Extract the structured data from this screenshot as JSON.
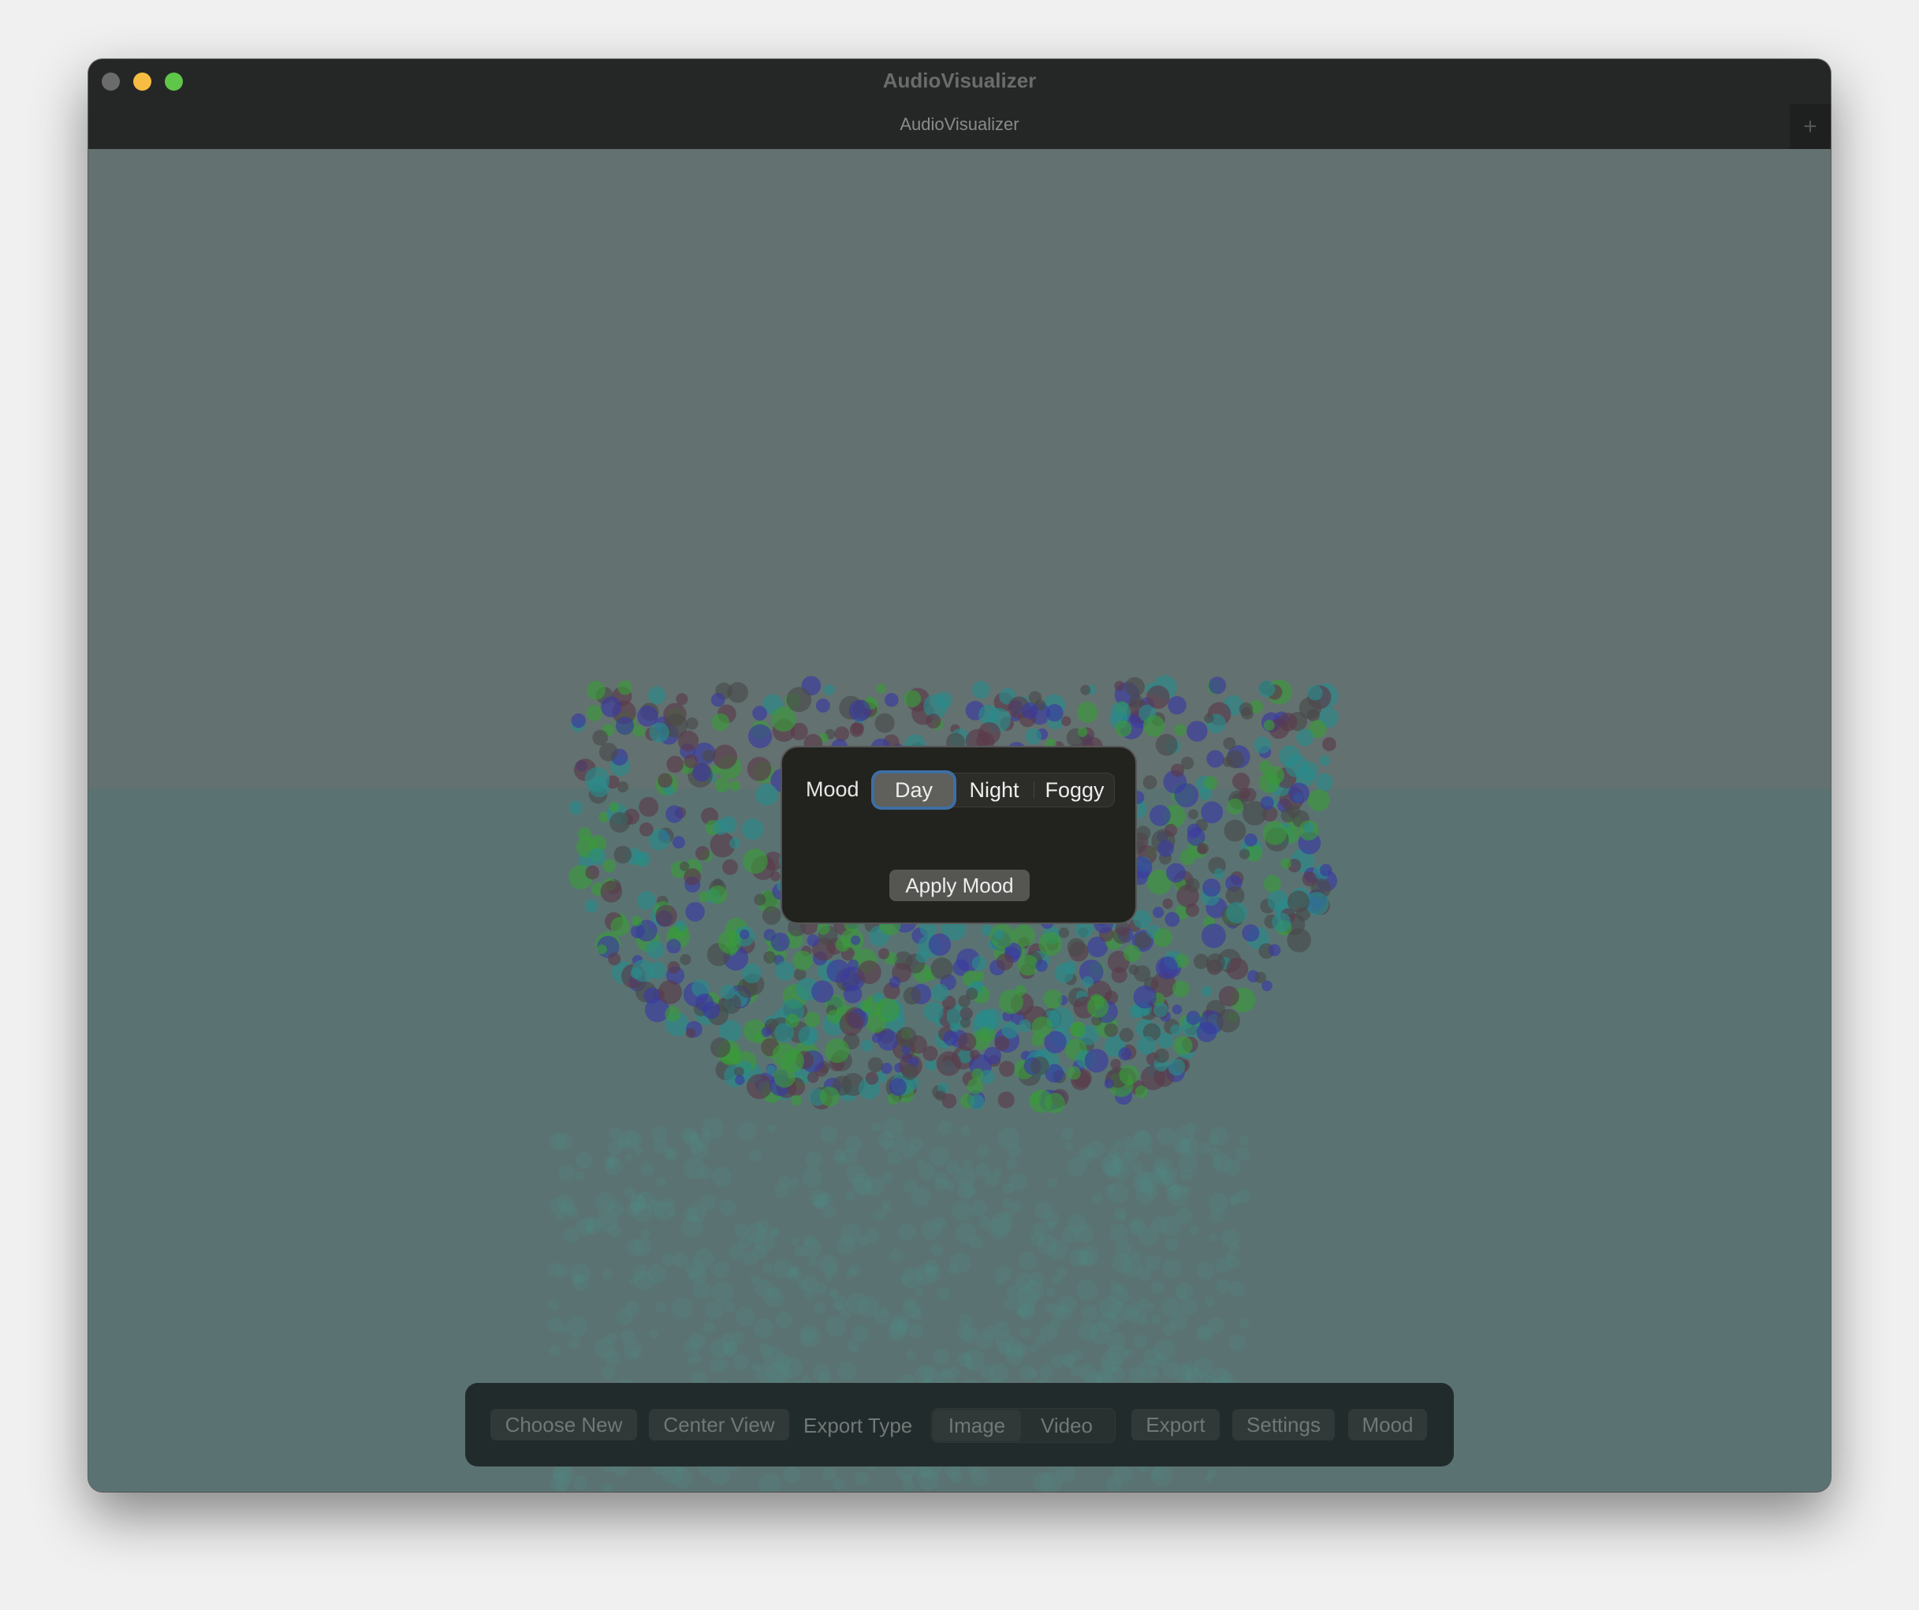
{
  "window": {
    "title": "AudioVisualizer",
    "tab_title": "AudioVisualizer",
    "new_tab_icon": "plus-icon",
    "traffic_lights": {
      "close": "#6b6b6b",
      "minimize": "#f6bd42",
      "maximize": "#5fc64a"
    }
  },
  "scene": {
    "sky_color": "#637170",
    "ground_color": "#5a7372",
    "particle_colors": [
      "#3a3aa0",
      "#3a9a3a",
      "#2a8a8a",
      "#5a3a4a",
      "#4a4a4a"
    ]
  },
  "mood_dialog": {
    "label": "Mood",
    "options": [
      "Day",
      "Night",
      "Foggy"
    ],
    "selected": "Day",
    "apply_label": "Apply Mood"
  },
  "toolbar": {
    "choose_new": "Choose New",
    "center_view": "Center View",
    "export_type_label": "Export Type",
    "export_types": [
      "Image",
      "Video"
    ],
    "export_type_selected": "Image",
    "export": "Export",
    "settings": "Settings",
    "mood": "Mood"
  }
}
